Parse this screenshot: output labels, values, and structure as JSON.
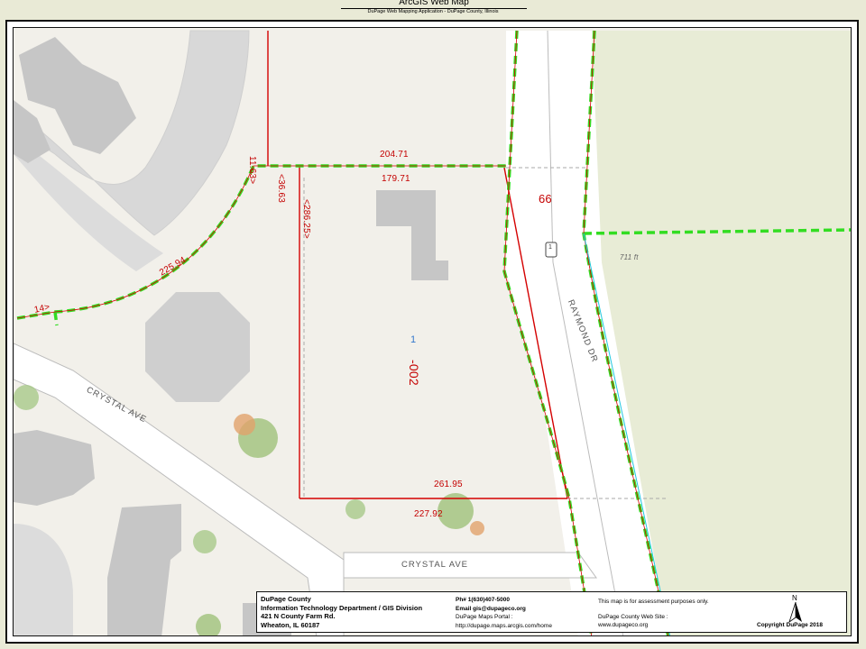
{
  "header": {
    "title": "ArcGIS Web Map",
    "subtitle": "DuPage Web Mapping Application - DuPage County, Illinois"
  },
  "map": {
    "dimensions": {
      "d1": "11.63>",
      "d2": "204.71",
      "d3": "<36.63",
      "d4": "179.71",
      "d5": "<286.25>",
      "d6": "225.94",
      "d7": "14>",
      "d8": "261.95",
      "d9": "227.92"
    },
    "parcel_id_prefix": "1",
    "parcel_id": "-002",
    "route_number": "66",
    "road_shield": "1",
    "elevation": "711 ft",
    "streets": {
      "raymond": "RAYMOND DR",
      "crystal_upper": "CRYSTAL AVE",
      "crystal_lower": "CRYSTAL AVE"
    },
    "colors": {
      "parcel_line": "#d40000",
      "highlight_dash": "#33dd22",
      "building": "#c6c6c6",
      "park": "#e8ecd6",
      "road": "#ffffff"
    }
  },
  "legend": {
    "org": {
      "line1": "DuPage County",
      "line2": "Information Technology Department / GIS Division",
      "line3": "421 N County Farm Rd.",
      "line4": "Wheaton, IL 60187"
    },
    "contact": {
      "phone": "Ph# 1(630)407-5000",
      "email": "Email gis@dupageco.org",
      "portal_label": "DuPage Maps Portal :",
      "portal_url": "http://dupage.maps.arcgis.com/home"
    },
    "info": {
      "disclaimer": "This map is for assessment purposes only.",
      "site_label": "DuPage County Web Site :",
      "site_url": "www.dupageco.org"
    },
    "north": "N",
    "copyright": "Copyright DuPage 2018"
  }
}
